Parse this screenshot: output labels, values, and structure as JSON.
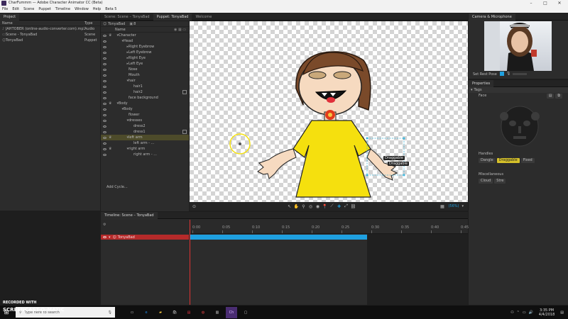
{
  "window": {
    "title": "CharFummm — Adobe Character Animator CC (Beta)"
  },
  "menu": [
    "File",
    "Edit",
    "Scene",
    "Puppet",
    "Timeline",
    "Window",
    "Help",
    "Beta 5"
  ],
  "project": {
    "tab": "Project",
    "col_name": "Name",
    "col_type": "Type",
    "rows": [
      {
        "name": "JAHTOBER (online-audio-converter.com).mp3",
        "type": "Audio"
      },
      {
        "name": "Scene - TonyaBad",
        "type": "Scene"
      },
      {
        "name": "TonyaBad",
        "type": "Puppet"
      }
    ]
  },
  "center_tabs": {
    "scene": "Scene: Scene – TonyaBad",
    "puppet": "Puppet: TonyaBad",
    "welcome": "Welcome"
  },
  "puppet_panel": {
    "header": "TonyaBad",
    "header_count": "8",
    "col_name": "Name",
    "items": [
      {
        "label": "Character",
        "indent": 0
      },
      {
        "label": "Head",
        "indent": 1
      },
      {
        "label": "Right Eyebrow",
        "indent": 2
      },
      {
        "label": "Left Eyebrow",
        "indent": 2
      },
      {
        "label": "Right Eye",
        "indent": 2
      },
      {
        "label": "Left Eye",
        "indent": 2
      },
      {
        "label": "Nose",
        "indent": 2
      },
      {
        "label": "Mouth",
        "indent": 2
      },
      {
        "label": "hair",
        "indent": 2
      },
      {
        "label": "hair1",
        "indent": 3
      },
      {
        "label": "hair2",
        "indent": 3
      },
      {
        "label": "face background",
        "indent": 2
      },
      {
        "label": "Body",
        "indent": 0
      },
      {
        "label": "Body",
        "indent": 1
      },
      {
        "label": "flower",
        "indent": 2
      },
      {
        "label": "dresses",
        "indent": 2
      },
      {
        "label": "dress2",
        "indent": 3
      },
      {
        "label": "dress1",
        "indent": 3
      },
      {
        "label": "left arm",
        "indent": 2
      },
      {
        "label": "left arm - ...",
        "indent": 3
      },
      {
        "label": "right arm",
        "indent": 2
      },
      {
        "label": "right arm - ...",
        "indent": 3
      }
    ],
    "add_cycle": "Add Cycle..."
  },
  "canvas": {
    "tag_labels": [
      "Draggable",
      "Draggable"
    ],
    "zoom": "(56%)"
  },
  "timeline": {
    "tab": "Timeline: Scene – TonyaBad",
    "track_name": "TonyaBad",
    "ticks": [
      "0:00",
      "0:05",
      "0:10",
      "0:15",
      "0:20",
      "0:25",
      "0:30",
      "0:35",
      "0:40",
      "0:45"
    ],
    "now_label": "00:00"
  },
  "camera": {
    "tab": "Camera & Microphone",
    "set_rest_pose": "Set Rest Pose"
  },
  "properties": {
    "tab": "Properties",
    "section": "Tags",
    "face_label": "Face",
    "handles_label": "Handles",
    "handle_tags": [
      "Dangle",
      "Draggable",
      "Fixed"
    ],
    "misc_label": "Miscellaneous",
    "misc_tags": [
      "Cloud",
      "Stre"
    ]
  },
  "taskbar": {
    "search": "Type here to search",
    "time": "3:35 PM",
    "date": "4/4/2018"
  },
  "watermark": {
    "line1": "RECORDED WITH",
    "line2": "SCREENCAST-O-MATIC"
  },
  "colors": {
    "accent": "#1fa0e0",
    "track_red": "#b52a2a",
    "selected_row": "#4d4b2a",
    "dress": "#f5e00e"
  }
}
